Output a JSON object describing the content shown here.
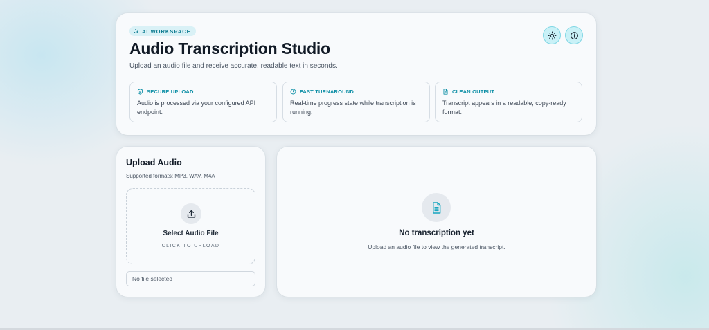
{
  "hero": {
    "badge": "AI WORKSPACE",
    "title": "Audio Transcription Studio",
    "subtitle": "Upload an audio file and receive accurate, readable text in seconds.",
    "features": [
      {
        "icon": "shield-check-icon",
        "title": "SECURE UPLOAD",
        "text": "Audio is processed via your configured API endpoint."
      },
      {
        "icon": "clock-icon",
        "title": "FAST TURNAROUND",
        "text": "Real-time progress state while transcription is running."
      },
      {
        "icon": "document-icon",
        "title": "CLEAN OUTPUT",
        "text": "Transcript appears in a readable, copy-ready format."
      }
    ],
    "actions": [
      "theme-toggle",
      "info"
    ]
  },
  "upload": {
    "title": "Upload Audio",
    "formats": "Supported formats: MP3, WAV, M4A",
    "select_label": "Select Audio File",
    "click_label": "CLICK TO UPLOAD",
    "file_status": "No file selected"
  },
  "result": {
    "empty_title": "No transcription yet",
    "empty_text": "Upload an audio file to view the generated transcript."
  },
  "colors": {
    "accent": "#0e8fa6",
    "accent_light": "#c9f1f7",
    "card_bg": "#f8fafc",
    "page_bg": "#e9eef2"
  }
}
